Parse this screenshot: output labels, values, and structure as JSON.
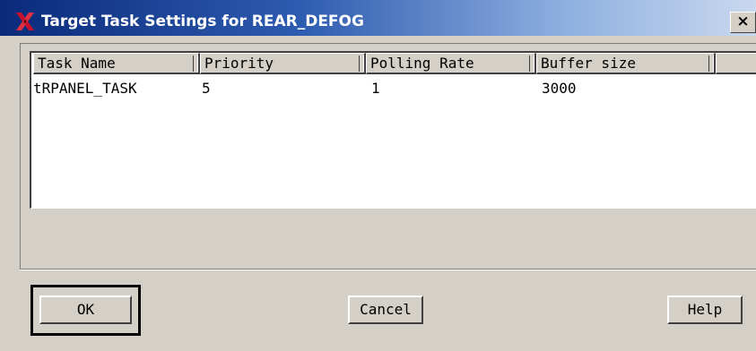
{
  "window": {
    "title": "Target Task Settings for REAR_DEFOG",
    "close_label": "×"
  },
  "table": {
    "columns": [
      "Task Name",
      "Priority",
      "Polling Rate",
      "Buffer size",
      ""
    ],
    "rows": [
      [
        "tRPANEL_TASK",
        "5",
        "1",
        "3000"
      ]
    ]
  },
  "buttons": {
    "ok": "OK",
    "cancel": "Cancel",
    "help": "Help"
  },
  "colors": {
    "title_start": "#0a2a7a",
    "title_end": "#c9d8ee",
    "icon_red": "#c8102e",
    "dialog_bg": "#d4d0c8"
  },
  "icons": {
    "app": "x-window-icon",
    "close": "close-icon"
  }
}
